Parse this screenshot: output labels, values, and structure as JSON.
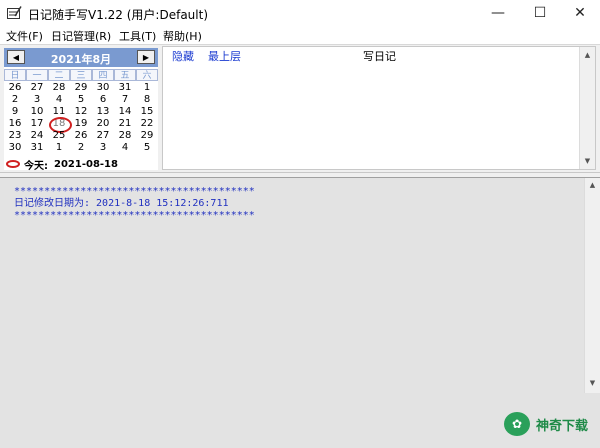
{
  "window": {
    "title": "日记随手写V1.22 (用户:Default)",
    "min_glyph": "—",
    "max_glyph": "☐",
    "close_glyph": "✕"
  },
  "menu": [
    "文件(F)",
    "日记管理(R)",
    "工具(T)",
    "帮助(H)"
  ],
  "calendar": {
    "month_title": "2021年8月",
    "prev_glyph": "◀",
    "next_glyph": "▶",
    "weekdays": [
      "日",
      "一",
      "二",
      "三",
      "四",
      "五",
      "六"
    ],
    "weeks": [
      [
        "26",
        "27",
        "28",
        "29",
        "30",
        "31",
        "1"
      ],
      [
        "2",
        "3",
        "4",
        "5",
        "6",
        "7",
        "8"
      ],
      [
        "9",
        "10",
        "11",
        "12",
        "13",
        "14",
        "15"
      ],
      [
        "16",
        "17",
        "18",
        "19",
        "20",
        "21",
        "22"
      ],
      [
        "23",
        "24",
        "25",
        "26",
        "27",
        "28",
        "29"
      ],
      [
        "30",
        "31",
        "1",
        "2",
        "3",
        "4",
        "5"
      ]
    ],
    "today_label": "今天:",
    "today_date": "2021-08-18"
  },
  "diary_toolbar": {
    "hide_label": "隐藏",
    "top_label": "最上层",
    "title": "写日记"
  },
  "log": {
    "stars": "****************************************",
    "modified_line": "日记修改日期为: 2021-8-18 15:12:26:711"
  },
  "watermark": {
    "text": "神奇下载"
  },
  "colors": {
    "calendar_header": "#7a9ad0",
    "link_blue": "#1a3ad0",
    "log_blue": "#2030c0",
    "today_circle": "#d02020",
    "watermark_green": "#2aa05a"
  }
}
